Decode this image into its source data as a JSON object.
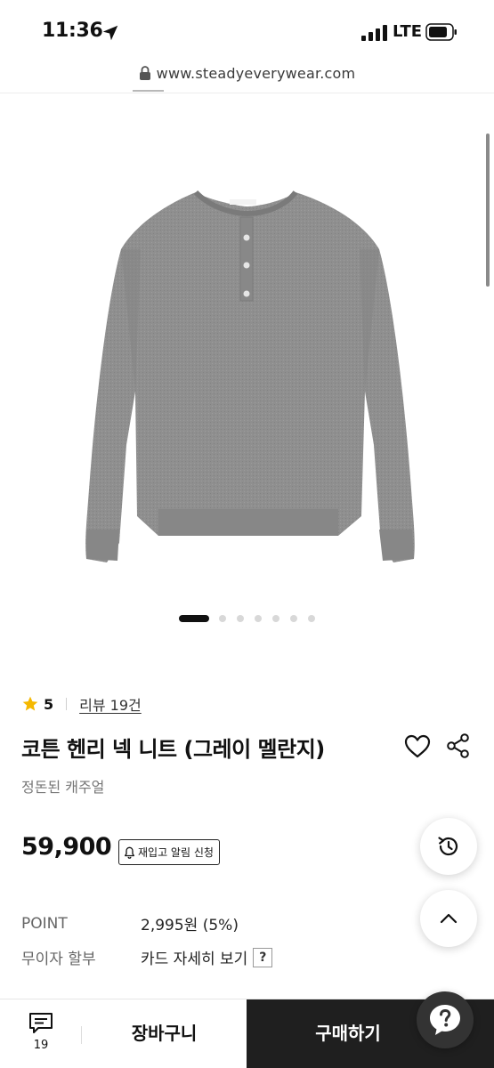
{
  "status_bar": {
    "time": "11:36",
    "network": "LTE"
  },
  "url_bar": {
    "url": "www.steadyeverywear.com"
  },
  "gallery": {
    "total_slides": 7,
    "active_slide": 1
  },
  "product": {
    "rating": "5",
    "review_link": "리뷰 19건",
    "title": "코튼 헨리 넥 니트 (그레이 멜란지)",
    "subtitle": "정돈된 캐주얼",
    "price": "59,900",
    "restock_button": "재입고 알림 신청",
    "details": [
      {
        "label": "POINT",
        "value": "2,995원 (5%)"
      },
      {
        "label": "무이자 할부",
        "value": "카드 자세히 보기"
      }
    ],
    "help_mark": "?"
  },
  "bottom_bar": {
    "chat_count": "19",
    "cart_label": "장바구니",
    "buy_label": "구매하기"
  },
  "colors": {
    "buy_button": "#1f1f1f",
    "star": "#f5b800",
    "sweater": "#8e8e8e"
  }
}
